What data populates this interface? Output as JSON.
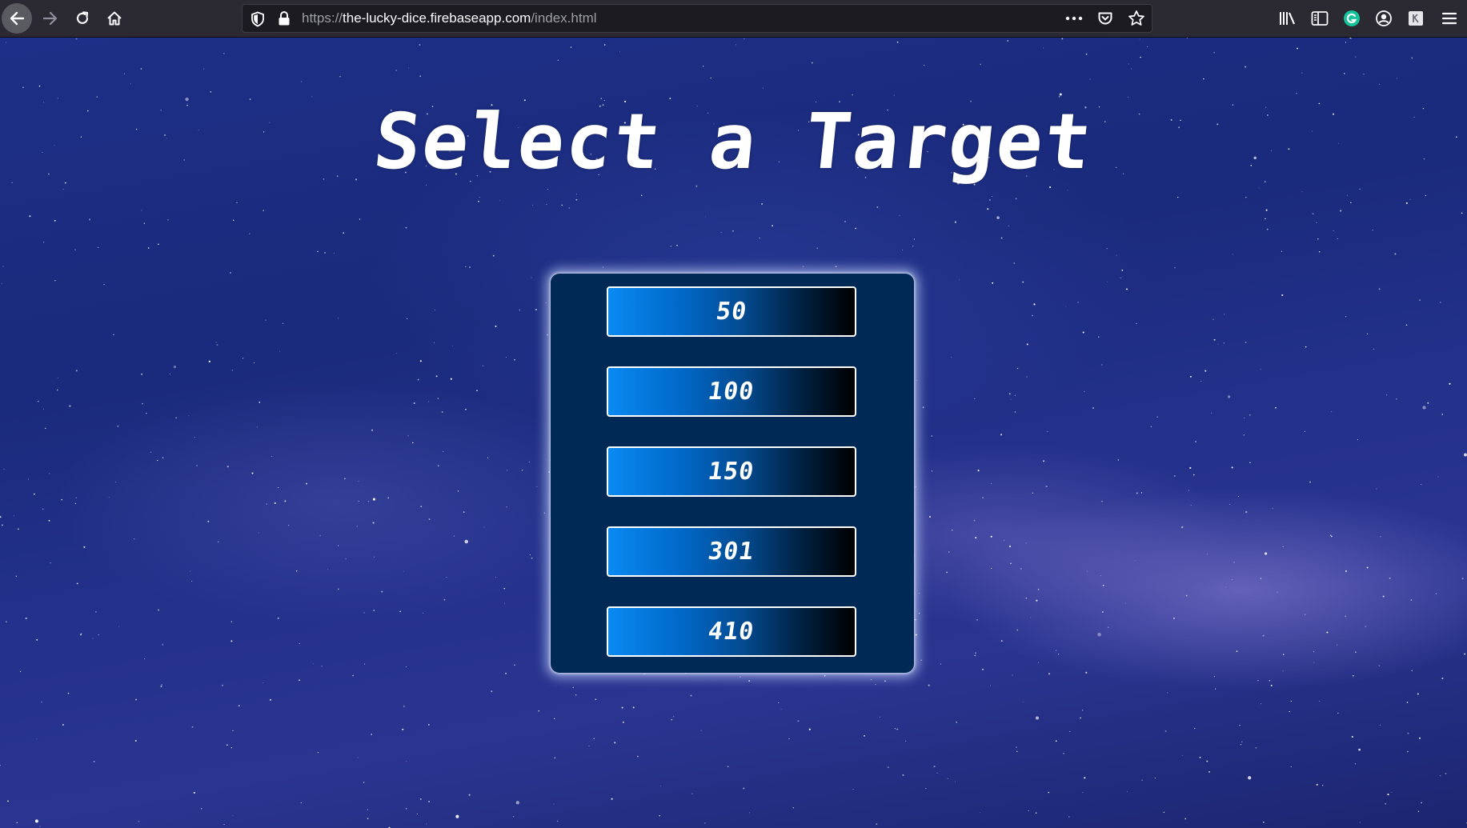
{
  "browser": {
    "url": {
      "scheme": "https://",
      "host": "the-lucky-dice.firebaseapp.com",
      "path": "/index.html"
    },
    "icons": {
      "back": "back-arrow-icon",
      "forward": "forward-arrow-icon",
      "reload": "reload-icon",
      "home": "home-icon",
      "tracking": "shield-icon",
      "lock": "lock-icon",
      "more": "more-dots-icon",
      "pocket": "pocket-icon",
      "bookmark": "star-icon",
      "library": "library-icon",
      "sidebar": "sidebar-icon",
      "grammarly": "grammarly-icon",
      "account": "account-icon",
      "extension": "extension-icon",
      "menu": "hamburger-menu-icon"
    }
  },
  "page": {
    "title": "Select a Target",
    "targets": [
      {
        "label": "50"
      },
      {
        "label": "100"
      },
      {
        "label": "150"
      },
      {
        "label": "301"
      },
      {
        "label": "410"
      }
    ],
    "colors": {
      "panel": "#002a55",
      "button_start": "#0a8af3",
      "button_end": "#000000",
      "title": "#ffffff"
    }
  }
}
